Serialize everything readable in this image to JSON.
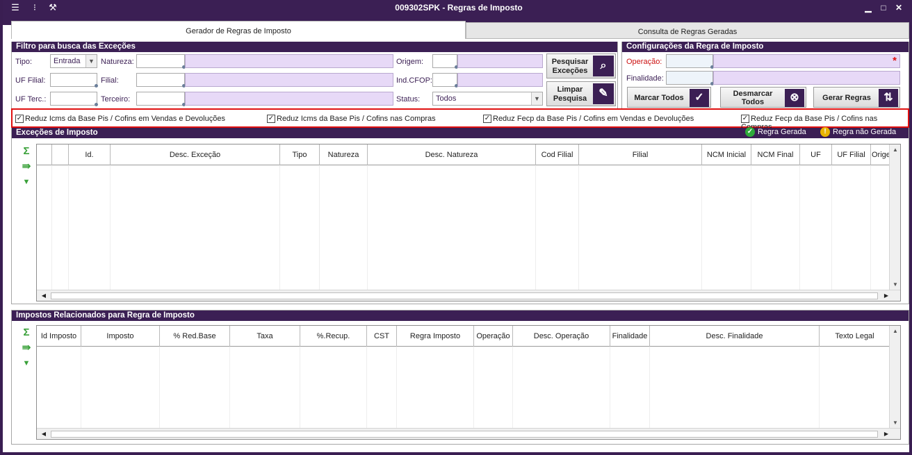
{
  "window": {
    "title": "009302SPK - Regras de Imposto",
    "controls": {
      "minimize": "▁",
      "maximize": "□",
      "close": "✕"
    }
  },
  "tabs": [
    {
      "label": "Gerador de Regras de Imposto",
      "active": true
    },
    {
      "label": "Consulta de Regras Geradas",
      "active": false
    }
  ],
  "filter": {
    "title": "Filtro para busca das Exceções",
    "tipo_label": "Tipo:",
    "tipo_value": "Entrada",
    "natureza_label": "Natureza:",
    "origem_label": "Origem:",
    "uf_filial_label": "UF Filial:",
    "filial_label": "Filial:",
    "ind_cfop_label": "Ind.CFOP:",
    "uf_terc_label": "UF Terc.:",
    "terceiro_label": "Terceiro:",
    "status_label": "Status:",
    "status_value": "Todos",
    "pesquisar_line1": "Pesquisar",
    "pesquisar_line2": "Exceções",
    "limpar_line1": "Limpar",
    "limpar_line2": "Pesquisa"
  },
  "config": {
    "title": "Configurações da Regra de Imposto",
    "operacao_label": "Operação:",
    "required_mark": "*",
    "finalidade_label": "Finalidade:",
    "marcar_label": "Marcar Todos",
    "desmarcar_line1": "Desmarcar",
    "desmarcar_line2": "Todos",
    "gerar_label": "Gerar Regras"
  },
  "checkboxes": [
    {
      "label": "Reduz Icms da Base Pis / Cofins em Vendas e Devoluções",
      "checked": true
    },
    {
      "label": "Reduz Icms da Base Pis / Cofins nas Compras",
      "checked": true
    },
    {
      "label": "Reduz Fecp da Base Pis / Cofins em Vendas e Devoluções",
      "checked": true
    },
    {
      "label": "Reduz Fecp da Base Pis / Cofins nas Compras",
      "checked": true
    }
  ],
  "checkmark": "✓",
  "excecoes": {
    "title": "Exceções de Imposto",
    "legend_gerada": "Regra Gerada",
    "legend_nao_gerada": "Regra não Gerada",
    "legend_colors": {
      "gerada": "#2eaa3a",
      "nao_gerada": "#e8b400"
    },
    "columns": [
      "",
      "",
      "Id.",
      "Desc. Exceção",
      "Tipo",
      "Natureza",
      "Desc. Natureza",
      "Cod Filial",
      "Filial",
      "NCM Inicial",
      "NCM Final",
      "UF",
      "UF Filial",
      "Origem"
    ]
  },
  "impostos": {
    "title": "Impostos Relacionados para Regra de Imposto",
    "columns": [
      "Id Imposto",
      "Imposto",
      "% Red.Base",
      "Taxa",
      "%.Recup.",
      "CST",
      "Regra Imposto",
      "Operação",
      "Desc. Operação",
      "Finalidade",
      "Desc. Finalidade",
      "Texto Legal"
    ]
  },
  "colors": {
    "brand": "#3b1f54",
    "highlight_border": "#e01010",
    "lilac": "#e7d9f7"
  },
  "icons": {
    "sigma": "Σ",
    "export": "⇛",
    "expand": "▼",
    "nao_gerada_mark": "!"
  }
}
